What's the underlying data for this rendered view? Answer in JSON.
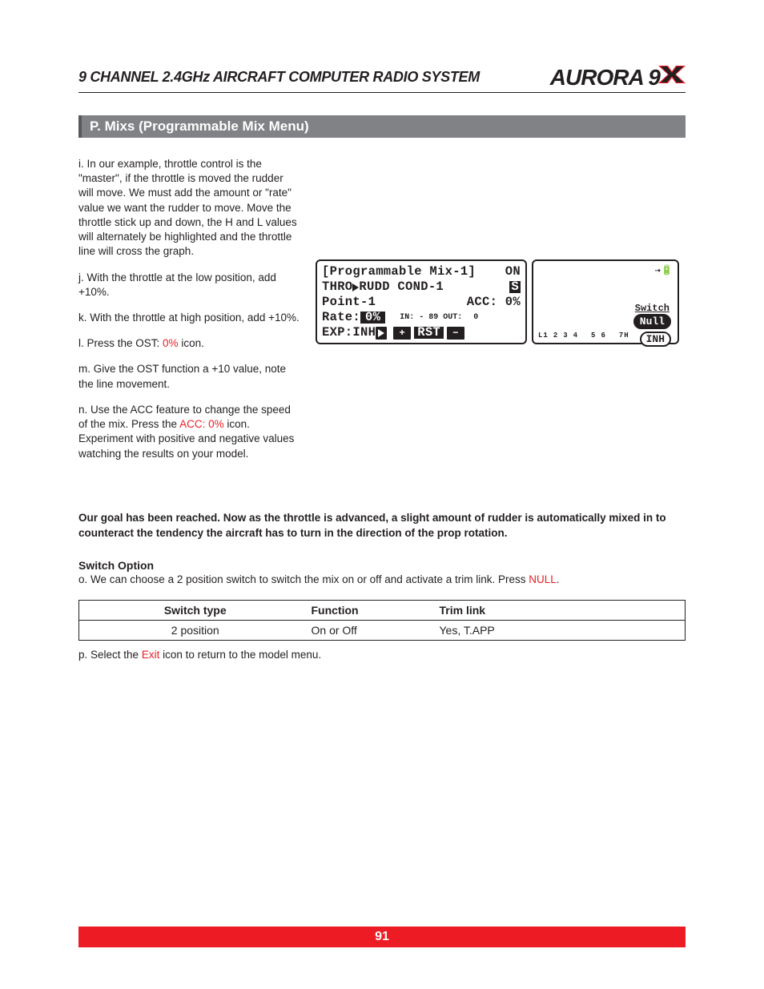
{
  "header": {
    "title": "9 CHANNEL 2.4GHz AIRCRAFT COMPUTER RADIO SYSTEM",
    "logo_main": "AURORA 9",
    "logo_suffix_alt": "X logo mark"
  },
  "section_title": "P. Mixs (Programmable Mix Menu)",
  "steps": {
    "i": "i. In our example, throttle control is the \"master\", if the throttle is moved the rudder will move. We must add the amount or \"rate\" value we want the rudder to move. Move the throttle stick up and down, the H and L values will alternately be highlighted and the throttle line will cross the graph.",
    "j": "j. With the throttle at the low position, add +10%.",
    "k": "k. With the throttle at high position, add +10%.",
    "l_pre": "l. Press the OST: ",
    "l_red": "0%",
    "l_post": " icon.",
    "m": "m. Give the OST function a +10 value, note the line movement.",
    "n_pre": "n. Use the ACC feature to change the speed of the mix.  Press the ",
    "n_red": "ACC: 0%",
    "n_post": " icon. Experiment with positive and negative values watching the results on your model."
  },
  "lcd": {
    "l1_a": "[Programmable Mix-1]",
    "l1_b": "ON",
    "l2_a": "THRO",
    "l2_b": "RUDD COND-1",
    "l2_s": "S",
    "l3_a": "Point-1",
    "l3_b": "ACC: 0%",
    "l4_a": "Rate:",
    "l4_inv": "0%",
    "l4_b": "IN: - 89 OUT:",
    "l4_c": "0",
    "l5_a": "EXP:INH",
    "l5_plus": "+",
    "l5_rst": "RST",
    "l5_minus": "−",
    "right_rf": "⇢🔋",
    "right_switch": "Switch",
    "right_null": "Null",
    "right_inh": "INH",
    "right_ticks_left": "L1",
    "right_ticks_right": "7H",
    "right_ticks": [
      "2",
      "3",
      "4",
      "5",
      "6"
    ]
  },
  "goal": "Our goal has been reached. Now as the throttle is advanced, a slight amount of rudder is automatically mixed in to counteract the tendency the aircraft has to turn in the direction of the prop rotation.",
  "switch_option": {
    "heading": "Switch Option",
    "o_pre": "o. We can choose a 2 position switch to switch the mix on or off and activate a trim link. Press ",
    "o_red": "NULL",
    "o_post": "."
  },
  "table": {
    "h1": "Switch type",
    "h2": "Function",
    "h3": "Trim link",
    "r1c1": "2 position",
    "r1c2": "On or Off",
    "r1c3": "Yes, T.APP"
  },
  "after": {
    "p_pre": "p. Select the ",
    "p_red": "Exit",
    "p_post": " icon to return to the model menu."
  },
  "page_number": "91"
}
